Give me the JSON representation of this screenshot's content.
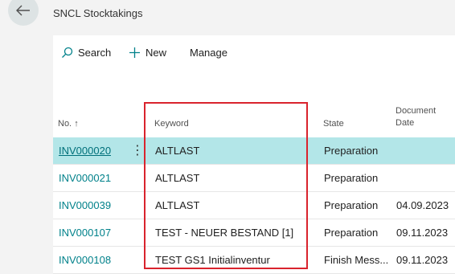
{
  "page": {
    "title": "SNCL Stocktakings"
  },
  "toolbar": {
    "search_label": "Search",
    "new_label": "New",
    "manage_label": "Manage"
  },
  "columns": {
    "no": "No.",
    "no_sort": "↑",
    "keyword": "Keyword",
    "state": "State",
    "document_date_line1": "Document",
    "document_date_line2": "Date"
  },
  "rows": [
    {
      "no": "INV000020",
      "keyword": "ALTLAST",
      "state": "Preparation",
      "document_date": ""
    },
    {
      "no": "INV000021",
      "keyword": "ALTLAST",
      "state": "Preparation",
      "document_date": ""
    },
    {
      "no": "INV000039",
      "keyword": "ALTLAST",
      "state": "Preparation",
      "document_date": "04.09.2023"
    },
    {
      "no": "INV000107",
      "keyword": "TEST - NEUER BESTAND [1]",
      "state": "Preparation",
      "document_date": "09.11.2023"
    },
    {
      "no": "INV000108",
      "keyword": "TEST GS1 Initialinventur",
      "state": "Finish Mess...",
      "document_date": "09.11.2023"
    }
  ],
  "selected_row": 0,
  "colors": {
    "accent": "#00818a",
    "selected_row": "#b3e6e8",
    "highlight": "#d9232d"
  }
}
